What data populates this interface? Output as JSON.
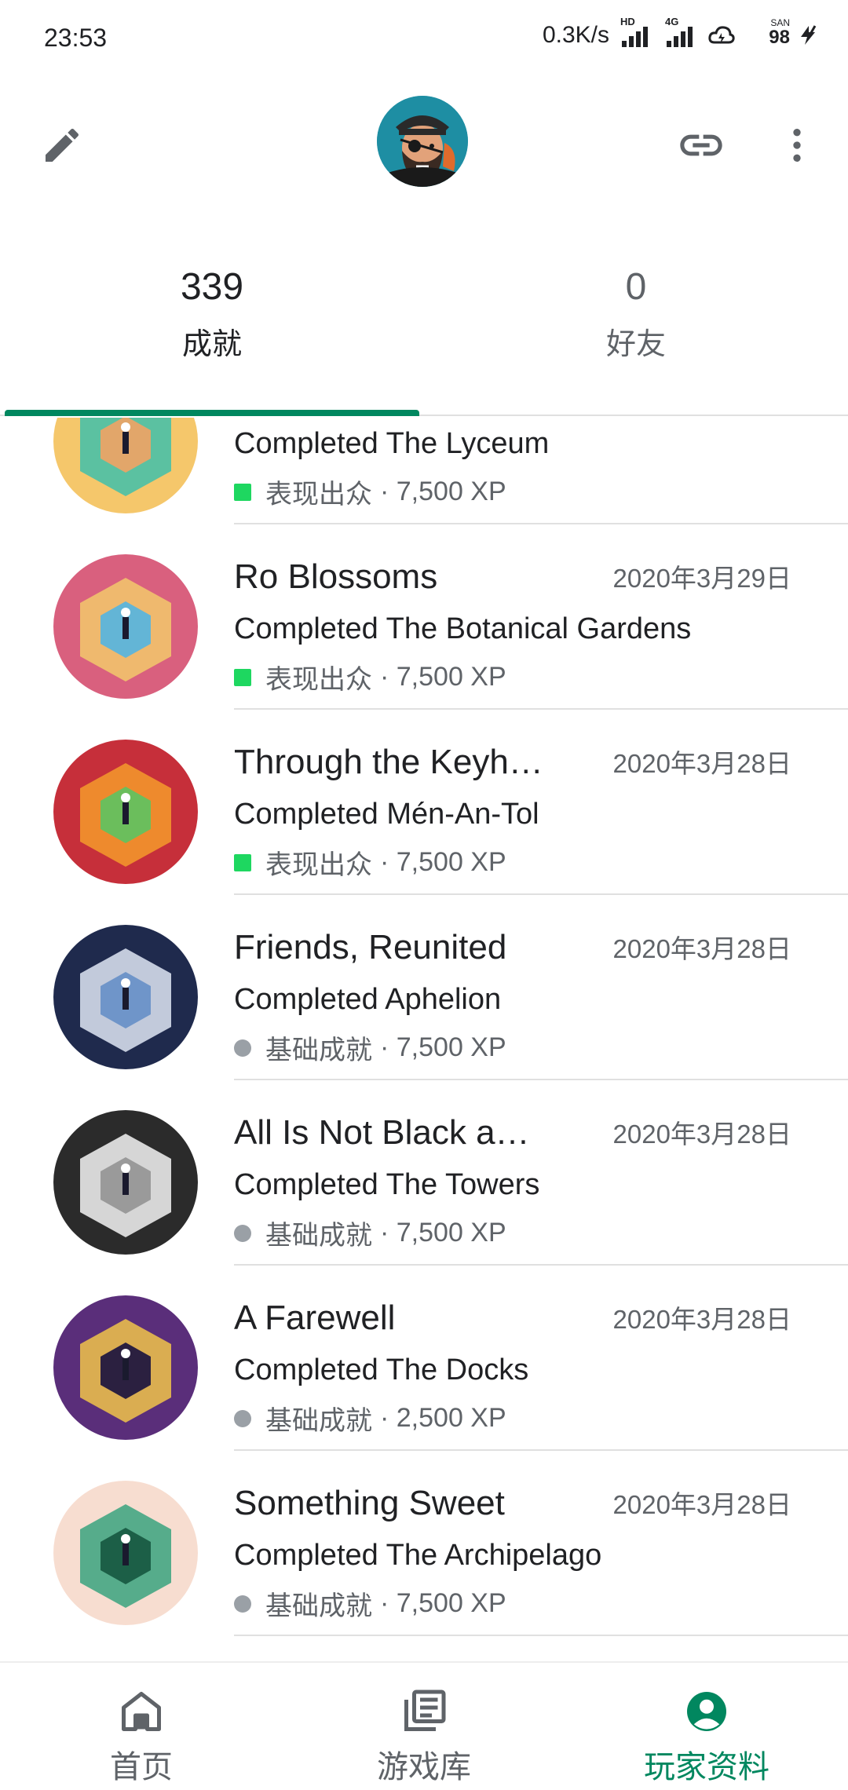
{
  "status_bar": {
    "time": "23:53",
    "speed": "0.3K/s",
    "hd_tag": "HD",
    "net_tag": "4G",
    "san_tag": "SAN",
    "battery": "98"
  },
  "header": {
    "edit_icon": "pencil-icon",
    "avatar_icon": "pirate-avatar",
    "link_icon": "link-icon",
    "more_icon": "more-vert-icon"
  },
  "tabs": [
    {
      "count": "339",
      "label": "成就",
      "active": true
    },
    {
      "count": "0",
      "label": "好友",
      "active": false
    }
  ],
  "achievements": [
    {
      "title": "",
      "date": "",
      "subtitle": "Completed The Lyceum",
      "rarity": "表现出众",
      "xp": "· 7,500 XP",
      "marker": "square",
      "colors": [
        "#f5c76b",
        "#3fbfaa",
        "#e2a66a"
      ]
    },
    {
      "title": "Ro Blossoms",
      "date": "2020年3月29日",
      "subtitle": "Completed The Botanical Gardens",
      "rarity": "表现出众",
      "xp": "· 7,500 XP",
      "marker": "square",
      "colors": [
        "#d9607e",
        "#f2c96b",
        "#63b5d6"
      ]
    },
    {
      "title": "Through the Keyh…",
      "date": "2020年3月28日",
      "subtitle": "Completed Mén-An-Tol",
      "rarity": "表现出众",
      "xp": "· 7,500 XP",
      "marker": "square",
      "colors": [
        "#c62f3a",
        "#f49a2b",
        "#6bbe5c"
      ]
    },
    {
      "title": "Friends, Reunited",
      "date": "2020年3月28日",
      "subtitle": "Completed Aphelion",
      "rarity": "基础成就",
      "xp": "· 7,500 XP",
      "marker": "dot",
      "colors": [
        "#1f2a4d",
        "#dfe6f5",
        "#6f95c9"
      ]
    },
    {
      "title": "All Is Not Black a…",
      "date": "2020年3月28日",
      "subtitle": "Completed The Towers",
      "rarity": "基础成就",
      "xp": "· 7,500 XP",
      "marker": "dot",
      "colors": [
        "#2b2b2b",
        "#f4f4f4",
        "#9a9a9a"
      ]
    },
    {
      "title": "A Farewell",
      "date": "2020年3月28日",
      "subtitle": "Completed The Docks",
      "rarity": "基础成就",
      "xp": "· 2,500 XP",
      "marker": "dot",
      "colors": [
        "#5a2e7a",
        "#f1c34a",
        "#2b2040"
      ]
    },
    {
      "title": "Something Sweet",
      "date": "2020年3月28日",
      "subtitle": "Completed The Archipelago",
      "rarity": "基础成就",
      "xp": "· 7,500 XP",
      "marker": "dot",
      "colors": [
        "#f7ddd0",
        "#3aa37f",
        "#1c5f47"
      ]
    }
  ],
  "bottom_nav": [
    {
      "label": "首页",
      "icon": "home-icon",
      "active": false
    },
    {
      "label": "游戏库",
      "icon": "library-icon",
      "active": false
    },
    {
      "label": "玩家资料",
      "icon": "account-circle-icon",
      "active": true
    }
  ]
}
